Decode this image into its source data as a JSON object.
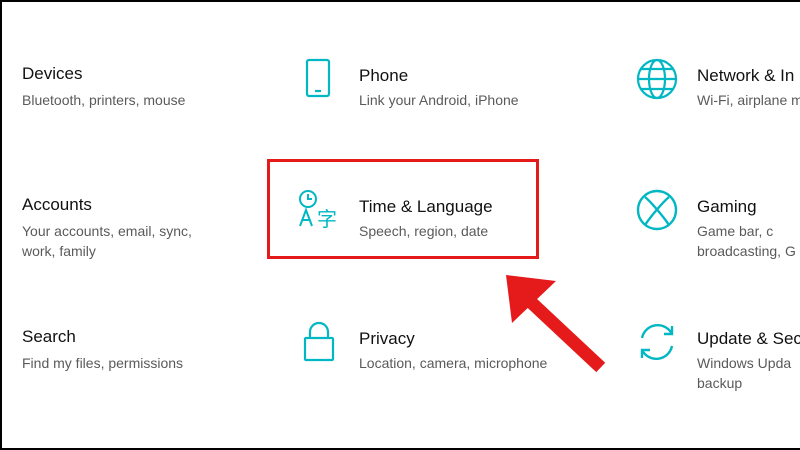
{
  "tiles": {
    "devices": {
      "title": "Devices",
      "desc": "Bluetooth, printers, mouse"
    },
    "phone": {
      "title": "Phone",
      "desc": "Link your Android, iPhone",
      "icon": "phone-icon"
    },
    "network": {
      "title": "Network & In",
      "desc": "Wi-Fi, airplane m",
      "icon": "globe-icon"
    },
    "accounts": {
      "title": "Accounts",
      "desc_line1": "Your accounts, email, sync,",
      "desc_line2": "work, family"
    },
    "time_language": {
      "title": "Time & Language",
      "desc": "Speech, region, date",
      "icon": "time-language-icon"
    },
    "gaming": {
      "title": "Gaming",
      "desc_line1": "Game bar, c",
      "desc_line2": "broadcasting, G",
      "icon": "xbox-icon"
    },
    "search": {
      "title": "Search",
      "desc": "Find my files, permissions"
    },
    "privacy": {
      "title": "Privacy",
      "desc": "Location, camera, microphone",
      "icon": "lock-icon"
    },
    "update": {
      "title": "Update & Sec",
      "desc_line1": "Windows Upda",
      "desc_line2": "backup",
      "icon": "sync-icon"
    }
  },
  "colors": {
    "accent": "#00b7c3",
    "highlight": "#e51a1a"
  }
}
